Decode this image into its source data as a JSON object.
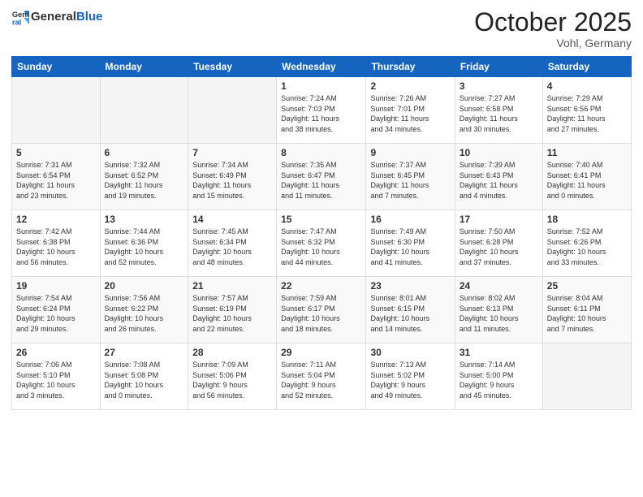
{
  "logo": {
    "general": "General",
    "blue": "Blue"
  },
  "header": {
    "month": "October 2025",
    "location": "Vohl, Germany"
  },
  "weekdays": [
    "Sunday",
    "Monday",
    "Tuesday",
    "Wednesday",
    "Thursday",
    "Friday",
    "Saturday"
  ],
  "weeks": [
    [
      {
        "day": "",
        "info": ""
      },
      {
        "day": "",
        "info": ""
      },
      {
        "day": "",
        "info": ""
      },
      {
        "day": "1",
        "info": "Sunrise: 7:24 AM\nSunset: 7:03 PM\nDaylight: 11 hours\nand 38 minutes."
      },
      {
        "day": "2",
        "info": "Sunrise: 7:26 AM\nSunset: 7:01 PM\nDaylight: 11 hours\nand 34 minutes."
      },
      {
        "day": "3",
        "info": "Sunrise: 7:27 AM\nSunset: 6:58 PM\nDaylight: 11 hours\nand 30 minutes."
      },
      {
        "day": "4",
        "info": "Sunrise: 7:29 AM\nSunset: 6:56 PM\nDaylight: 11 hours\nand 27 minutes."
      }
    ],
    [
      {
        "day": "5",
        "info": "Sunrise: 7:31 AM\nSunset: 6:54 PM\nDaylight: 11 hours\nand 23 minutes."
      },
      {
        "day": "6",
        "info": "Sunrise: 7:32 AM\nSunset: 6:52 PM\nDaylight: 11 hours\nand 19 minutes."
      },
      {
        "day": "7",
        "info": "Sunrise: 7:34 AM\nSunset: 6:49 PM\nDaylight: 11 hours\nand 15 minutes."
      },
      {
        "day": "8",
        "info": "Sunrise: 7:35 AM\nSunset: 6:47 PM\nDaylight: 11 hours\nand 11 minutes."
      },
      {
        "day": "9",
        "info": "Sunrise: 7:37 AM\nSunset: 6:45 PM\nDaylight: 11 hours\nand 7 minutes."
      },
      {
        "day": "10",
        "info": "Sunrise: 7:39 AM\nSunset: 6:43 PM\nDaylight: 11 hours\nand 4 minutes."
      },
      {
        "day": "11",
        "info": "Sunrise: 7:40 AM\nSunset: 6:41 PM\nDaylight: 11 hours\nand 0 minutes."
      }
    ],
    [
      {
        "day": "12",
        "info": "Sunrise: 7:42 AM\nSunset: 6:38 PM\nDaylight: 10 hours\nand 56 minutes."
      },
      {
        "day": "13",
        "info": "Sunrise: 7:44 AM\nSunset: 6:36 PM\nDaylight: 10 hours\nand 52 minutes."
      },
      {
        "day": "14",
        "info": "Sunrise: 7:45 AM\nSunset: 6:34 PM\nDaylight: 10 hours\nand 48 minutes."
      },
      {
        "day": "15",
        "info": "Sunrise: 7:47 AM\nSunset: 6:32 PM\nDaylight: 10 hours\nand 44 minutes."
      },
      {
        "day": "16",
        "info": "Sunrise: 7:49 AM\nSunset: 6:30 PM\nDaylight: 10 hours\nand 41 minutes."
      },
      {
        "day": "17",
        "info": "Sunrise: 7:50 AM\nSunset: 6:28 PM\nDaylight: 10 hours\nand 37 minutes."
      },
      {
        "day": "18",
        "info": "Sunrise: 7:52 AM\nSunset: 6:26 PM\nDaylight: 10 hours\nand 33 minutes."
      }
    ],
    [
      {
        "day": "19",
        "info": "Sunrise: 7:54 AM\nSunset: 6:24 PM\nDaylight: 10 hours\nand 29 minutes."
      },
      {
        "day": "20",
        "info": "Sunrise: 7:56 AM\nSunset: 6:22 PM\nDaylight: 10 hours\nand 26 minutes."
      },
      {
        "day": "21",
        "info": "Sunrise: 7:57 AM\nSunset: 6:19 PM\nDaylight: 10 hours\nand 22 minutes."
      },
      {
        "day": "22",
        "info": "Sunrise: 7:59 AM\nSunset: 6:17 PM\nDaylight: 10 hours\nand 18 minutes."
      },
      {
        "day": "23",
        "info": "Sunrise: 8:01 AM\nSunset: 6:15 PM\nDaylight: 10 hours\nand 14 minutes."
      },
      {
        "day": "24",
        "info": "Sunrise: 8:02 AM\nSunset: 6:13 PM\nDaylight: 10 hours\nand 11 minutes."
      },
      {
        "day": "25",
        "info": "Sunrise: 8:04 AM\nSunset: 6:11 PM\nDaylight: 10 hours\nand 7 minutes."
      }
    ],
    [
      {
        "day": "26",
        "info": "Sunrise: 7:06 AM\nSunset: 5:10 PM\nDaylight: 10 hours\nand 3 minutes."
      },
      {
        "day": "27",
        "info": "Sunrise: 7:08 AM\nSunset: 5:08 PM\nDaylight: 10 hours\nand 0 minutes."
      },
      {
        "day": "28",
        "info": "Sunrise: 7:09 AM\nSunset: 5:06 PM\nDaylight: 9 hours\nand 56 minutes."
      },
      {
        "day": "29",
        "info": "Sunrise: 7:11 AM\nSunset: 5:04 PM\nDaylight: 9 hours\nand 52 minutes."
      },
      {
        "day": "30",
        "info": "Sunrise: 7:13 AM\nSunset: 5:02 PM\nDaylight: 9 hours\nand 49 minutes."
      },
      {
        "day": "31",
        "info": "Sunrise: 7:14 AM\nSunset: 5:00 PM\nDaylight: 9 hours\nand 45 minutes."
      },
      {
        "day": "",
        "info": ""
      }
    ]
  ]
}
